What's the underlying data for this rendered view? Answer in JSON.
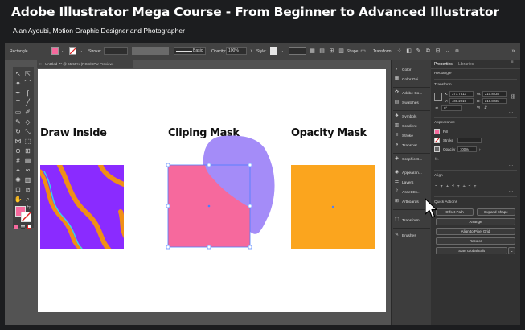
{
  "course": {
    "title": "Adobe Illustrator Mega Course - From Beginner to Advanced Illustrator",
    "subtitle": "Alan Ayoubi, Motion Graphic Designer and Photographer"
  },
  "control_bar": {
    "selection": "Rectangle",
    "stroke_label": "Stroke:",
    "stroke_profile": "Basic",
    "opacity_label": "Opacity:",
    "opacity_value": "100%",
    "style_label": "Style:",
    "shape_label": "Shape:",
    "transform_label": "Transform"
  },
  "document_tab": {
    "title": "Untitled-7* @ 65.55% (RGB/CPU Preview)",
    "close": "×"
  },
  "canvas": {
    "headings": [
      "Draw Inside",
      "Cliping Mask",
      "Opacity Mask"
    ],
    "colors": {
      "purple": "#8a2bff",
      "orange": "#f08f16",
      "cyan": "#34d6ee",
      "pink": "#f6699d",
      "lavender": "#a48cf8",
      "amber": "#fba51e",
      "selection": "#4a7fff"
    }
  },
  "dock": {
    "groups": [
      [
        "Color",
        "Color Gui..."
      ],
      [
        "Adobe Co...",
        "Swatches"
      ],
      [
        "Symbols",
        "Gradient",
        "Stroke",
        "Transpar..."
      ],
      [
        "Graphic S..."
      ],
      [
        "Appearan...",
        "Layers",
        "Asset Ex...",
        "Artboards"
      ],
      [
        "Transform"
      ],
      [
        "Brushes"
      ]
    ]
  },
  "properties": {
    "tabs": [
      "Properties",
      "Libraries"
    ],
    "selection": "Rectangle",
    "transform": {
      "title": "Transform",
      "x_label": "X:",
      "x": "377.7513",
      "y_label": "Y:",
      "y": "408.2019",
      "w_label": "W:",
      "w": "210.8235",
      "h_label": "H:",
      "h": "210.8235",
      "angle": "0°"
    },
    "appearance": {
      "title": "Appearance",
      "fill_label": "Fill",
      "stroke_label": "Stroke",
      "opacity_label": "Opacity",
      "opacity": "100%",
      "fx": "fx."
    },
    "align": {
      "title": "Align"
    },
    "quick_actions": {
      "title": "Quick Actions",
      "offset_path": "Offset Path",
      "expand_shape": "Expand Shape",
      "arrange": "Arrange",
      "align_pixel": "Align to Pixel Grid",
      "recolor": "Recolor",
      "global_edit": "Start Global Edit"
    },
    "more": "..."
  }
}
